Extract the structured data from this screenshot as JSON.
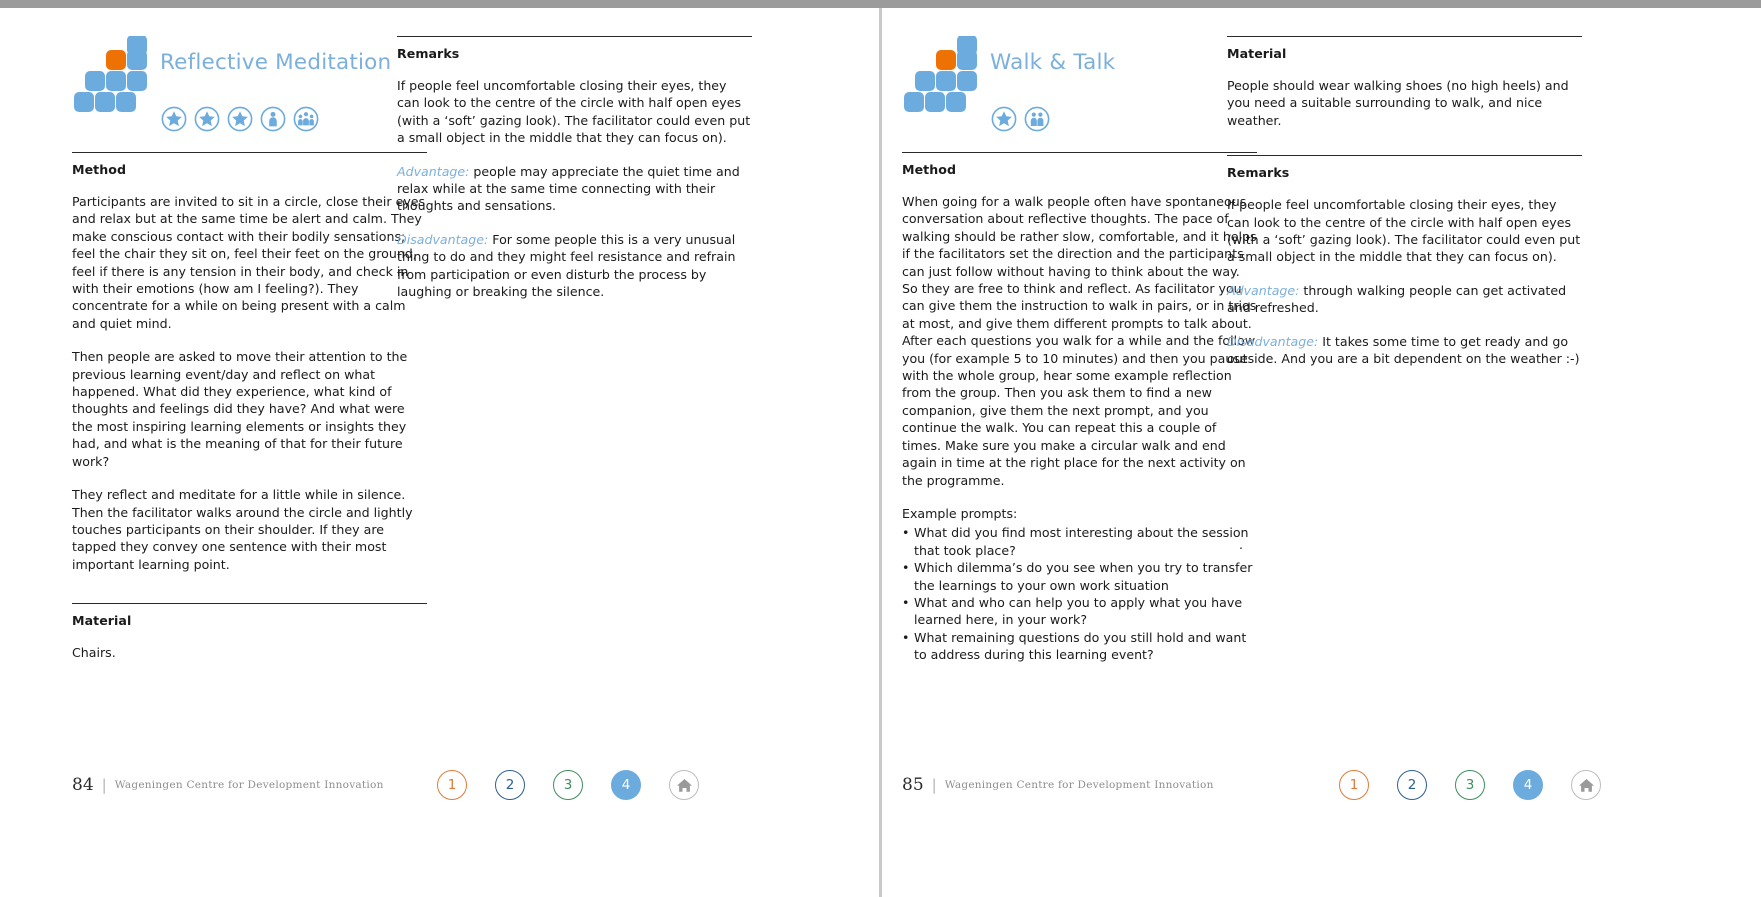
{
  "document": {
    "type": "facilitation-methods-booklet-spread",
    "top_bar_color": "#9b9b9b",
    "accent_color": "#7cb0dc",
    "logo_orange": "#ee7203",
    "logo_blue": "#6cabdd"
  },
  "pages": [
    {
      "id": "left",
      "title": "Reflective Meditation",
      "badges": [
        "star-badge",
        "star-badge",
        "star-badge",
        "individual-badge",
        "group-badge"
      ],
      "main_column": {
        "heading": "Method",
        "paragraphs": [
          "Participants are invited to sit in a circle, close their eyes and relax but at the same time be alert and calm. They make conscious contact with their bodily sensations; feel the chair they sit on, feel their feet on the ground, feel if there is any tension in their body, and check in with their emotions (how am I feeling?). They concentrate for a while on being present with a calm and quiet mind.",
          "Then people are asked to move their attention to the previous learning event/day and reflect on what happened. What did they experience, what kind of thoughts and feelings did they have? And what were the most inspiring learning elements or insights they had, and what is the meaning of that for their future work?",
          "They reflect and meditate for a little while in silence. Then the facilitator walks around the circle and lightly touches participants on their shoulder. If they are tapped they convey one sentence with their most important learning point."
        ],
        "material_heading": "Material",
        "material_text": "Chairs."
      },
      "side_column": {
        "remarks_heading": "Remarks",
        "remarks_text": "If people feel uncomfortable closing their eyes, they can look to the centre of the circle with half open eyes (with a ‘soft’ gazing look). The facilitator could even put a small object in the middle that they can focus on).",
        "advantage_label": "Advantage:",
        "advantage_text": " people may appreciate the quiet time and relax while at the same time connecting with their thoughts and sensations.",
        "disadvantage_label": "Disadvantage:",
        "disadvantage_text": " For some people this is a very unusual thing to do and they might feel resistance and refrain from participation or even disturb the process by laughing or breaking the silence."
      },
      "footer": {
        "page_number": "84",
        "separator": "|",
        "organisation": "Wageningen Centre for Development Innovation"
      },
      "nav": {
        "items": [
          {
            "label": "1",
            "color": "#e07b39",
            "active": false
          },
          {
            "label": "2",
            "color": "#2c5f94",
            "active": false
          },
          {
            "label": "3",
            "color": "#3d8f5f",
            "active": false
          },
          {
            "label": "4",
            "color": "#6cabdd",
            "active": true
          }
        ],
        "home_label": "home-icon"
      }
    },
    {
      "id": "right",
      "title": "Walk & Talk",
      "badges": [
        "star-badge",
        "group-badge"
      ],
      "main_column": {
        "heading": "Method",
        "paragraphs": [
          "When going for a walk people often have spontaneous conversation about reflective thoughts. The pace of walking should be rather slow, comfortable, and it helps if the facilitators set the direction and the participants can just follow without having to think about the way. So they are free to think and reflect. As facilitator you can give them the instruction to walk in pairs, or in trios at most, and give them different prompts to talk about. After each questions you walk for a while and the follow you (for example 5 to 10 minutes) and then you pause with the whole group, hear some example reflection from the group. Then you ask them to find a new companion, give them the next prompt, and you continue the walk. You can repeat this a couple of times. Make sure you make a circular walk and end again in time at the right place for the next activity on the programme."
        ],
        "prompts_intro": "Example prompts:",
        "prompts": [
          "What did you find most interesting about the session that took place?",
          "Which dilemma’s do you see when you try to transfer the learnings to your own work situation",
          "What and who can help you to apply what you have learned here, in your work?",
          "What remaining questions do you still hold and want to address during this learning event?"
        ]
      },
      "side_column": {
        "material_heading": "Material",
        "material_text": "People should wear walking shoes (no high heels) and you need a suitable surrounding to walk, and nice weather.",
        "remarks_heading": "Remarks",
        "remarks_text": "If people feel uncomfortable closing their eyes, they can look to the centre of the circle with half open eyes (with a ‘soft’ gazing look). The facilitator could even put a small object in the middle that they can focus on).",
        "advantage_label": "Advantage:",
        "advantage_text": " through walking people can get activated and refreshed.",
        "disadvantage_label": "Disadvantage:",
        "disadvantage_text": " It takes some time to get ready and go outside. And you are a bit dependent on the weather :-)",
        "stray_mark": "."
      },
      "footer": {
        "page_number": "85",
        "separator": "|",
        "organisation": "Wageningen Centre for Development Innovation"
      },
      "nav": {
        "items": [
          {
            "label": "1",
            "color": "#e07b39",
            "active": false
          },
          {
            "label": "2",
            "color": "#2c5f94",
            "active": false
          },
          {
            "label": "3",
            "color": "#3d8f5f",
            "active": false
          },
          {
            "label": "4",
            "color": "#6cabdd",
            "active": true
          }
        ],
        "home_label": "home-icon"
      }
    }
  ]
}
